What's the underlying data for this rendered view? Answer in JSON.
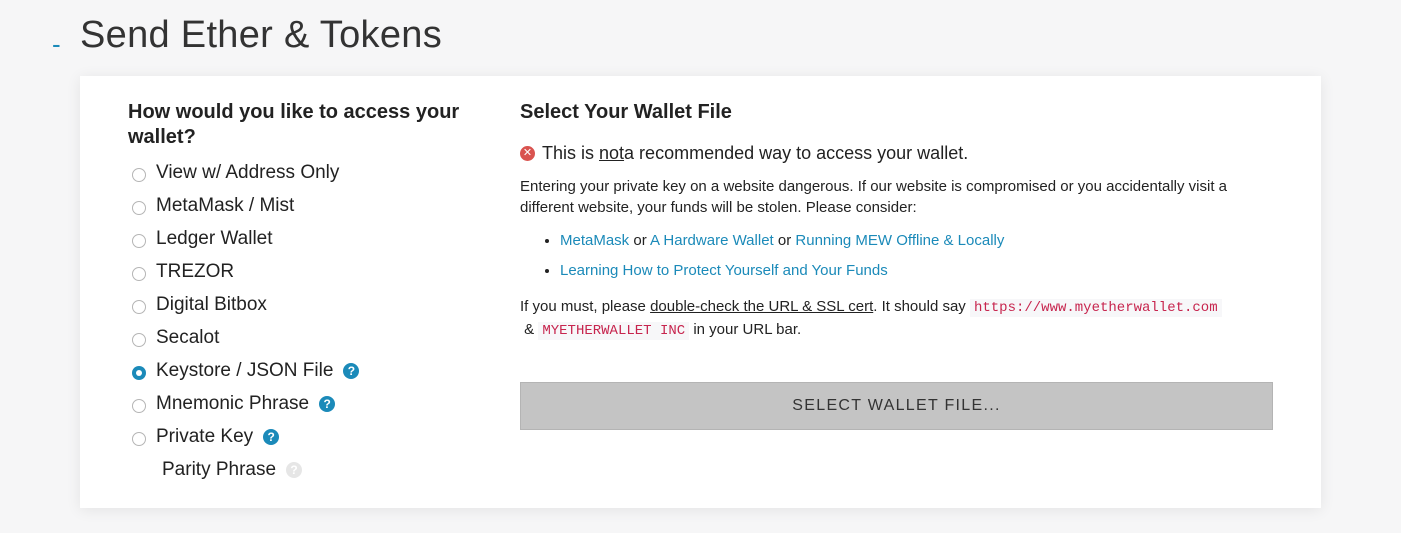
{
  "header": {
    "toggle": "-",
    "title": "Send Ether & Tokens"
  },
  "access": {
    "heading": "How would you like to access your wallet?",
    "options": [
      {
        "label": "View w/ Address Only",
        "checked": false,
        "help": false
      },
      {
        "label": "MetaMask / Mist",
        "checked": false,
        "help": false
      },
      {
        "label": "Ledger Wallet",
        "checked": false,
        "help": false
      },
      {
        "label": "TREZOR",
        "checked": false,
        "help": false
      },
      {
        "label": "Digital Bitbox",
        "checked": false,
        "help": false
      },
      {
        "label": "Secalot",
        "checked": false,
        "help": false
      },
      {
        "label": "Keystore / JSON File",
        "checked": true,
        "help": true
      },
      {
        "label": "Mnemonic Phrase",
        "checked": false,
        "help": true
      },
      {
        "label": "Private Key",
        "checked": false,
        "help": true
      }
    ],
    "parity_label": "Parity Phrase",
    "help_glyph": "?"
  },
  "wallet": {
    "heading": "Select Your Wallet File",
    "warning_prefix": "This is ",
    "warning_emph": "not",
    "warning_suffix": " a recommended way to access your wallet.",
    "warning_icon": "✕",
    "body": "Entering your private key on a website dangerous. If our website is compromised or you accidentally visit a different website, your funds will be stolen. Please consider:",
    "links_row1": {
      "metamask": "MetaMask",
      "or1": " or ",
      "hardware": "A Hardware Wallet",
      "or2": " or ",
      "offline": "Running MEW Offline & Locally"
    },
    "links_row2": "Learning How to Protect Yourself and Your Funds",
    "must_prefix": "If you must, please ",
    "must_link": "double-check the URL & SSL cert",
    "must_middle": ". It should say ",
    "url_code": "https://www.myetherwallet.com",
    "amp": " & ",
    "cert_code": "MYETHERWALLET INC",
    "must_suffix": " in your URL bar.",
    "button_label": "SELECT WALLET FILE..."
  },
  "colors": {
    "accent": "#1b8ab9",
    "danger": "#d9534f",
    "code": "#c7254e"
  }
}
